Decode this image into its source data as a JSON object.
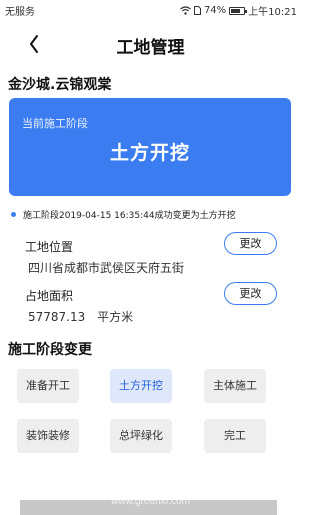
{
  "status_bar": {
    "carrier": "无服务",
    "battery": "74%",
    "battery_level": 0.74,
    "time": "上午10:21"
  },
  "header": {
    "title": "工地管理"
  },
  "site": {
    "name": "金沙城.云锦观棠"
  },
  "stage_card": {
    "label": "当前施工阶段",
    "value": "土方开挖",
    "color": "#3b7df0"
  },
  "log": {
    "text": "施工阶段2019-04-15 16:35:44成功变更为土方开挖"
  },
  "location": {
    "label": "工地位置",
    "value": "四川省成都市武侯区天府五街",
    "button": "更改"
  },
  "area": {
    "label": "占地面积",
    "value": "57787.13",
    "unit": "平方米",
    "button": "更改"
  },
  "stage_change": {
    "title": "施工阶段变更",
    "options": [
      {
        "label": "准备开工",
        "active": false
      },
      {
        "label": "土方开挖",
        "active": true
      },
      {
        "label": "主体施工",
        "active": false
      },
      {
        "label": "装饰装修",
        "active": false
      },
      {
        "label": "总坪绿化",
        "active": false
      },
      {
        "label": "完工",
        "active": false
      }
    ]
  },
  "watermark": "www.greenxf.com"
}
